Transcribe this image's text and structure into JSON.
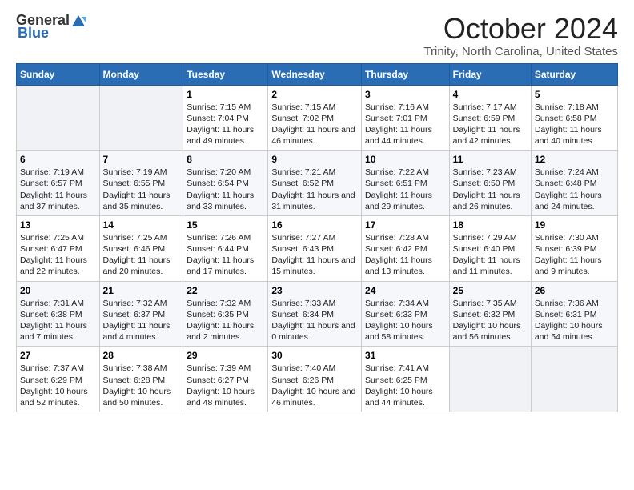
{
  "logo": {
    "general": "General",
    "blue": "Blue"
  },
  "title": "October 2024",
  "location": "Trinity, North Carolina, United States",
  "days_of_week": [
    "Sunday",
    "Monday",
    "Tuesday",
    "Wednesday",
    "Thursday",
    "Friday",
    "Saturday"
  ],
  "weeks": [
    [
      {
        "day": "",
        "info": ""
      },
      {
        "day": "",
        "info": ""
      },
      {
        "day": "1",
        "info": "Sunrise: 7:15 AM\nSunset: 7:04 PM\nDaylight: 11 hours and 49 minutes."
      },
      {
        "day": "2",
        "info": "Sunrise: 7:15 AM\nSunset: 7:02 PM\nDaylight: 11 hours and 46 minutes."
      },
      {
        "day": "3",
        "info": "Sunrise: 7:16 AM\nSunset: 7:01 PM\nDaylight: 11 hours and 44 minutes."
      },
      {
        "day": "4",
        "info": "Sunrise: 7:17 AM\nSunset: 6:59 PM\nDaylight: 11 hours and 42 minutes."
      },
      {
        "day": "5",
        "info": "Sunrise: 7:18 AM\nSunset: 6:58 PM\nDaylight: 11 hours and 40 minutes."
      }
    ],
    [
      {
        "day": "6",
        "info": "Sunrise: 7:19 AM\nSunset: 6:57 PM\nDaylight: 11 hours and 37 minutes."
      },
      {
        "day": "7",
        "info": "Sunrise: 7:19 AM\nSunset: 6:55 PM\nDaylight: 11 hours and 35 minutes."
      },
      {
        "day": "8",
        "info": "Sunrise: 7:20 AM\nSunset: 6:54 PM\nDaylight: 11 hours and 33 minutes."
      },
      {
        "day": "9",
        "info": "Sunrise: 7:21 AM\nSunset: 6:52 PM\nDaylight: 11 hours and 31 minutes."
      },
      {
        "day": "10",
        "info": "Sunrise: 7:22 AM\nSunset: 6:51 PM\nDaylight: 11 hours and 29 minutes."
      },
      {
        "day": "11",
        "info": "Sunrise: 7:23 AM\nSunset: 6:50 PM\nDaylight: 11 hours and 26 minutes."
      },
      {
        "day": "12",
        "info": "Sunrise: 7:24 AM\nSunset: 6:48 PM\nDaylight: 11 hours and 24 minutes."
      }
    ],
    [
      {
        "day": "13",
        "info": "Sunrise: 7:25 AM\nSunset: 6:47 PM\nDaylight: 11 hours and 22 minutes."
      },
      {
        "day": "14",
        "info": "Sunrise: 7:25 AM\nSunset: 6:46 PM\nDaylight: 11 hours and 20 minutes."
      },
      {
        "day": "15",
        "info": "Sunrise: 7:26 AM\nSunset: 6:44 PM\nDaylight: 11 hours and 17 minutes."
      },
      {
        "day": "16",
        "info": "Sunrise: 7:27 AM\nSunset: 6:43 PM\nDaylight: 11 hours and 15 minutes."
      },
      {
        "day": "17",
        "info": "Sunrise: 7:28 AM\nSunset: 6:42 PM\nDaylight: 11 hours and 13 minutes."
      },
      {
        "day": "18",
        "info": "Sunrise: 7:29 AM\nSunset: 6:40 PM\nDaylight: 11 hours and 11 minutes."
      },
      {
        "day": "19",
        "info": "Sunrise: 7:30 AM\nSunset: 6:39 PM\nDaylight: 11 hours and 9 minutes."
      }
    ],
    [
      {
        "day": "20",
        "info": "Sunrise: 7:31 AM\nSunset: 6:38 PM\nDaylight: 11 hours and 7 minutes."
      },
      {
        "day": "21",
        "info": "Sunrise: 7:32 AM\nSunset: 6:37 PM\nDaylight: 11 hours and 4 minutes."
      },
      {
        "day": "22",
        "info": "Sunrise: 7:32 AM\nSunset: 6:35 PM\nDaylight: 11 hours and 2 minutes."
      },
      {
        "day": "23",
        "info": "Sunrise: 7:33 AM\nSunset: 6:34 PM\nDaylight: 11 hours and 0 minutes."
      },
      {
        "day": "24",
        "info": "Sunrise: 7:34 AM\nSunset: 6:33 PM\nDaylight: 10 hours and 58 minutes."
      },
      {
        "day": "25",
        "info": "Sunrise: 7:35 AM\nSunset: 6:32 PM\nDaylight: 10 hours and 56 minutes."
      },
      {
        "day": "26",
        "info": "Sunrise: 7:36 AM\nSunset: 6:31 PM\nDaylight: 10 hours and 54 minutes."
      }
    ],
    [
      {
        "day": "27",
        "info": "Sunrise: 7:37 AM\nSunset: 6:29 PM\nDaylight: 10 hours and 52 minutes."
      },
      {
        "day": "28",
        "info": "Sunrise: 7:38 AM\nSunset: 6:28 PM\nDaylight: 10 hours and 50 minutes."
      },
      {
        "day": "29",
        "info": "Sunrise: 7:39 AM\nSunset: 6:27 PM\nDaylight: 10 hours and 48 minutes."
      },
      {
        "day": "30",
        "info": "Sunrise: 7:40 AM\nSunset: 6:26 PM\nDaylight: 10 hours and 46 minutes."
      },
      {
        "day": "31",
        "info": "Sunrise: 7:41 AM\nSunset: 6:25 PM\nDaylight: 10 hours and 44 minutes."
      },
      {
        "day": "",
        "info": ""
      },
      {
        "day": "",
        "info": ""
      }
    ]
  ]
}
